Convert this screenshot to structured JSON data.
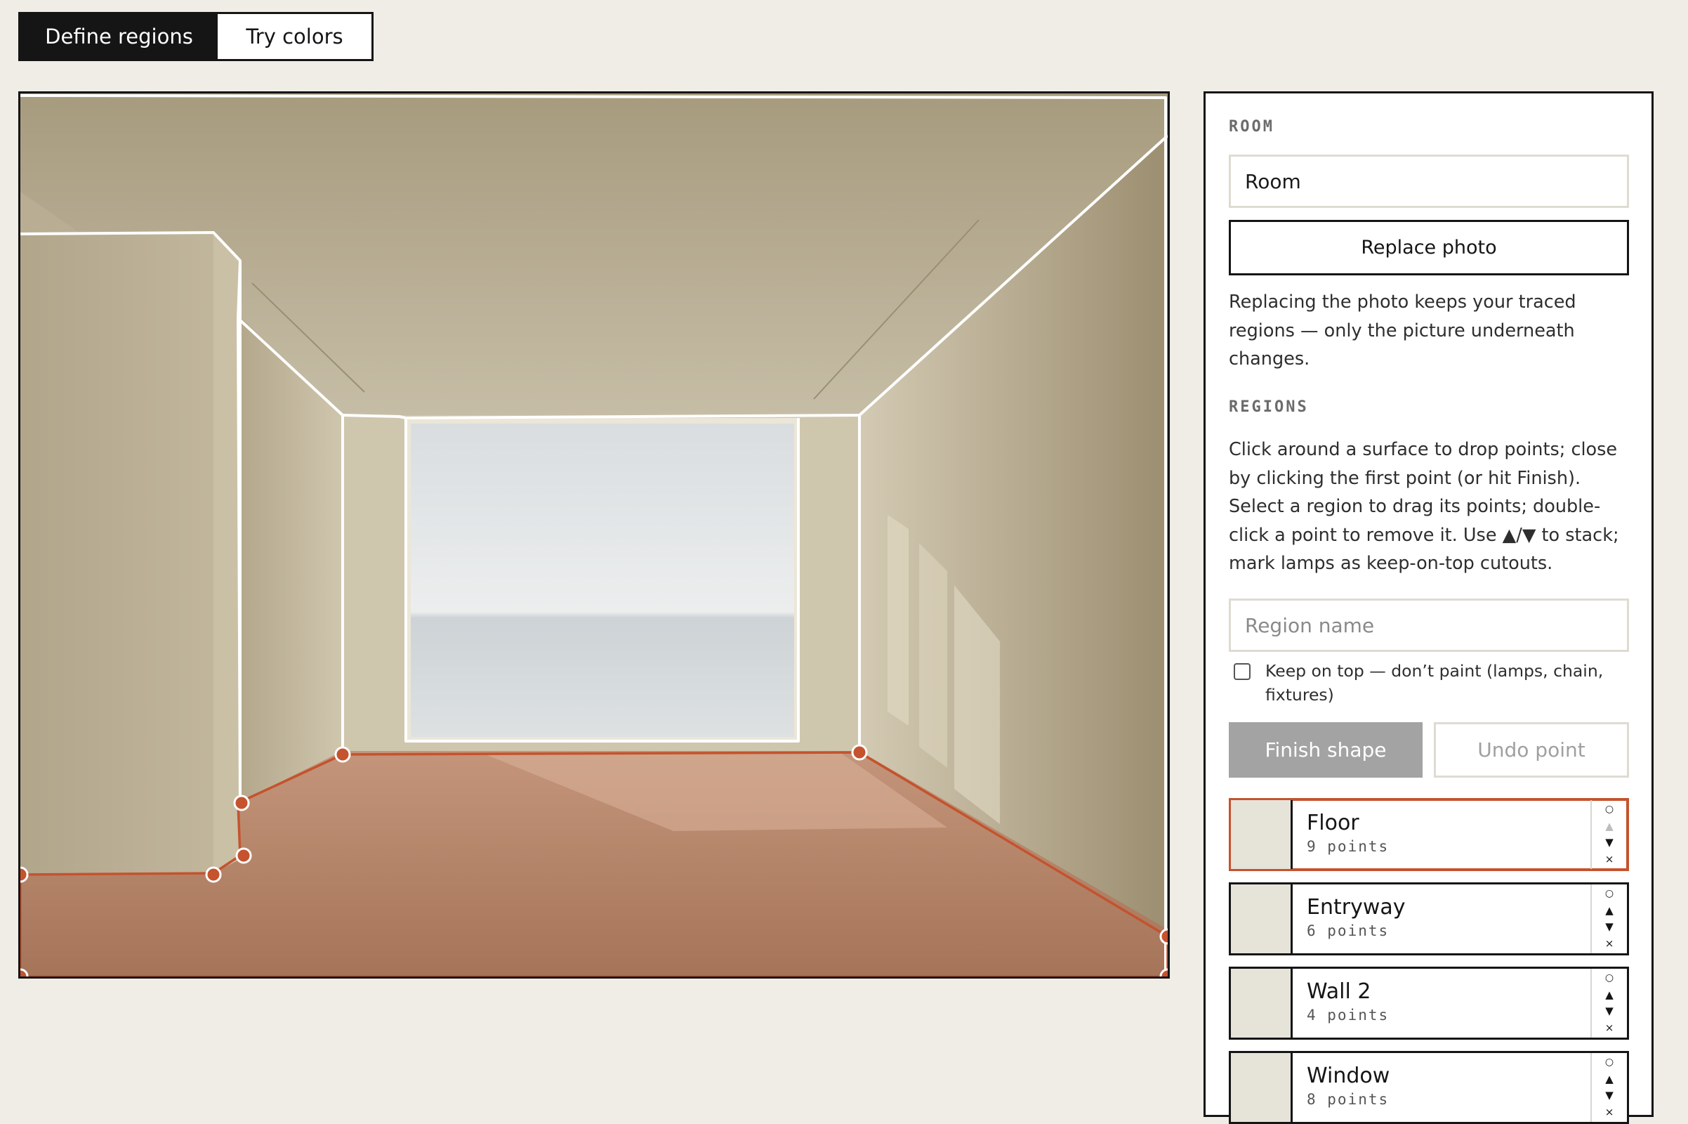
{
  "tabs": {
    "define": "Define regions",
    "try": "Try colors"
  },
  "panel": {
    "room_label": "ROOM",
    "room_value": "Room",
    "replace_button": "Replace photo",
    "replace_help": "Replacing the photo keeps your traced regions — only the picture underneath changes.",
    "regions_label": "REGIONS",
    "regions_help": "Click around a surface to drop points; close by clicking the first point (or hit Finish). Select a region to drag its points; double-click a point to remove it. Use ▲/▼ to stack; mark lamps as keep-on-top cutouts.",
    "region_name_placeholder": "Region name",
    "keep_on_top_label": "Keep on top — don’t paint (lamps, chain, fixtures)",
    "keep_on_top_checked": false,
    "finish_button": "Finish shape",
    "undo_button": "Undo point"
  },
  "regions": [
    {
      "name": "Floor",
      "points": "9 points",
      "selected": true,
      "swatch": "#e6e3d9"
    },
    {
      "name": "Entryway",
      "points": "6 points",
      "selected": false,
      "swatch": "#e6e3d9"
    },
    {
      "name": "Wall 2",
      "points": "4 points",
      "selected": false,
      "swatch": "#e6e3d9"
    },
    {
      "name": "Window",
      "points": "8 points",
      "selected": false,
      "swatch": "#e6e3d9"
    }
  ],
  "controls": {
    "solo": "○",
    "up": "▲",
    "down": "▼",
    "delete": "×"
  },
  "colors": {
    "accent": "#c4532e",
    "dark": "#151515",
    "background": "#f0ede6",
    "disabled_button": "#a3a3a3"
  }
}
